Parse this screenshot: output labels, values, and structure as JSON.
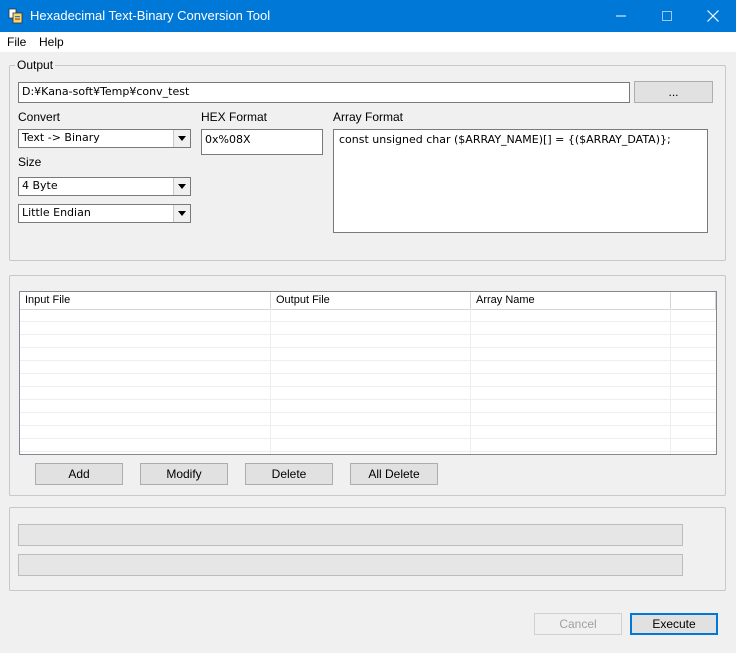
{
  "window": {
    "title": "Hexadecimal Text-Binary Conversion Tool"
  },
  "menu": {
    "file": "File",
    "help": "Help"
  },
  "output": {
    "legend": "Output",
    "path_value": "D:¥Kana-soft¥Temp¥conv_test",
    "browse_label": "..."
  },
  "convert": {
    "label": "Convert",
    "value": "Text -> Binary"
  },
  "size": {
    "label": "Size",
    "value": "4 Byte"
  },
  "endian": {
    "value": "Little Endian"
  },
  "hex_format": {
    "label": "HEX Format",
    "value": "0x%08X"
  },
  "array_format": {
    "label": "Array Format",
    "value": "const unsigned char ($ARRAY_NAME)[] = {($ARRAY_DATA)};"
  },
  "file_list": {
    "columns": [
      "Input File",
      "Output File",
      "Array Name",
      ""
    ],
    "rows": []
  },
  "buttons": {
    "add": "Add",
    "modify": "Modify",
    "delete": "Delete",
    "all_delete": "All Delete",
    "cancel": "Cancel",
    "execute": "Execute"
  },
  "progress": {
    "bar1": 0,
    "bar2": 0
  },
  "colors": {
    "titlebar": "#0078d7",
    "accent": "#0078d7"
  }
}
